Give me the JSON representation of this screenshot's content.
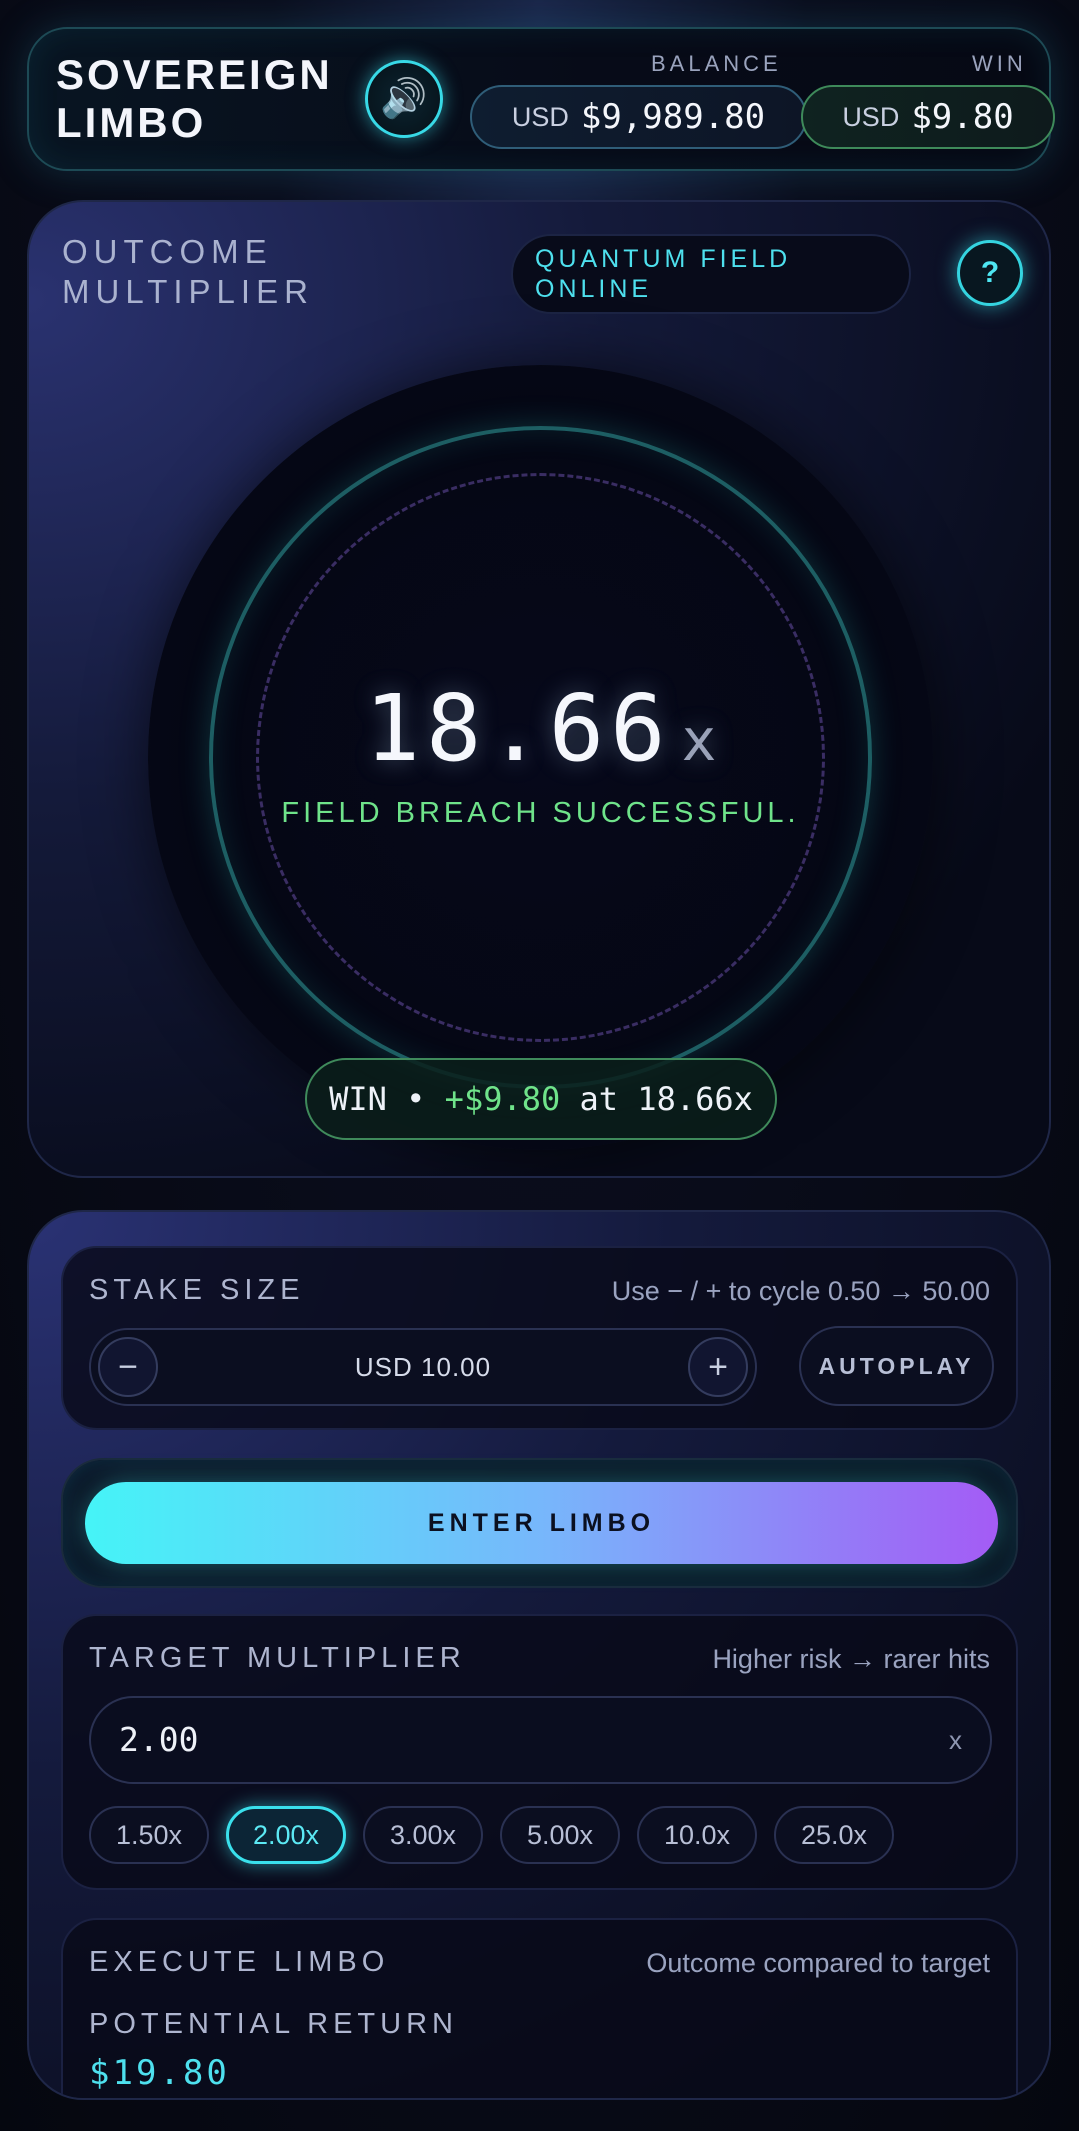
{
  "header": {
    "title_line1": "SOVEREIGN",
    "title_line2": "LIMBO",
    "sound_icon": "speaker-icon",
    "balance_label": "BALANCE",
    "balance_currency": "USD",
    "balance_amount": "$9,989.80",
    "win_label": "WIN",
    "win_currency": "USD",
    "win_amount": "$9.80"
  },
  "outcome": {
    "title_line1": "OUTCOME",
    "title_line2": "MULTIPLIER",
    "status_line1": "QUANTUM FIELD",
    "status_line2": "ONLINE",
    "help_label": "?",
    "multiplier": "18.66",
    "multiplier_suffix": "x",
    "message": "FIELD BREACH SUCCESSFUL.",
    "result_prefix": "WIN •",
    "result_amount": "+$9.80",
    "result_suffix": "at 18.66x"
  },
  "stake": {
    "title": "STAKE SIZE",
    "hint": "Use − / + to cycle 0.50 → 50.00",
    "minus": "−",
    "plus": "+",
    "value": "USD 10.00",
    "autoplay": "AUTOPLAY"
  },
  "enter": {
    "label": "ENTER LIMBO"
  },
  "target": {
    "title": "TARGET MULTIPLIER",
    "hint": "Higher risk → rarer hits",
    "value": "2.00",
    "suffix": "x",
    "presets": [
      "1.50x",
      "2.00x",
      "3.00x",
      "5.00x",
      "10.0x",
      "25.0x"
    ],
    "active_preset": "2.00x"
  },
  "execute": {
    "title": "EXECUTE LIMBO",
    "hint": "Outcome compared to target",
    "potential_label": "POTENTIAL RETURN",
    "potential_value": "$19.80"
  },
  "colors": {
    "accent_cyan": "#3ae0ec",
    "win_green": "#6fe38a",
    "button_gradient_start": "#45f4f7",
    "button_gradient_end": "#a45bf5"
  }
}
